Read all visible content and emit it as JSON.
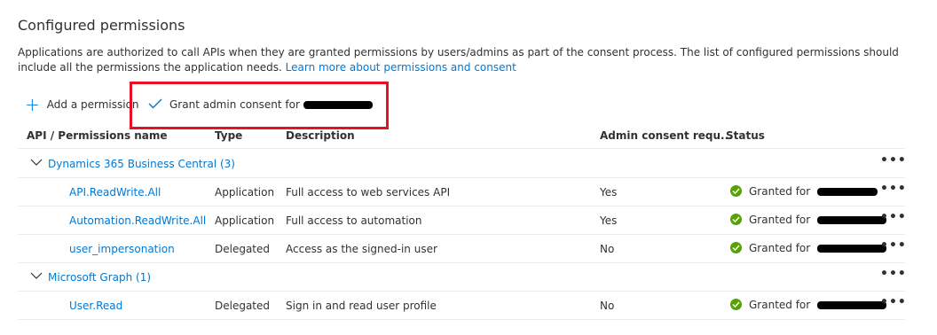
{
  "section": {
    "title": "Configured permissions",
    "description": "Applications are authorized to call APIs when they are granted permissions by users/admins as part of the consent process. The list of configured permissions should include all the permissions the application needs.",
    "learn_more": "Learn more about permissions and consent"
  },
  "toolbar": {
    "add_permission": "Add a permission",
    "grant_consent": "Grant admin consent for"
  },
  "colors": {
    "accent": "#0078d4",
    "highlight": "#e81123",
    "granted": "#57a300"
  },
  "table": {
    "headers": [
      "API / Permissions name",
      "Type",
      "Description",
      "Admin consent requ...",
      "Status"
    ],
    "groups": [
      {
        "name": "Dynamics 365 Business Central (3)",
        "rows": [
          {
            "name": "API.ReadWrite.All",
            "type": "Application",
            "description": "Full access to web services API",
            "admin_consent": "Yes",
            "status": "Granted for"
          },
          {
            "name": "Automation.ReadWrite.All",
            "type": "Application",
            "description": "Full access to automation",
            "admin_consent": "Yes",
            "status": "Granted for"
          },
          {
            "name": "user_impersonation",
            "type": "Delegated",
            "description": "Access as the signed-in user",
            "admin_consent": "No",
            "status": "Granted for"
          }
        ]
      },
      {
        "name": "Microsoft Graph (1)",
        "rows": [
          {
            "name": "User.Read",
            "type": "Delegated",
            "description": "Sign in and read user profile",
            "admin_consent": "No",
            "status": "Granted for"
          }
        ]
      }
    ],
    "more_label": "•••"
  }
}
